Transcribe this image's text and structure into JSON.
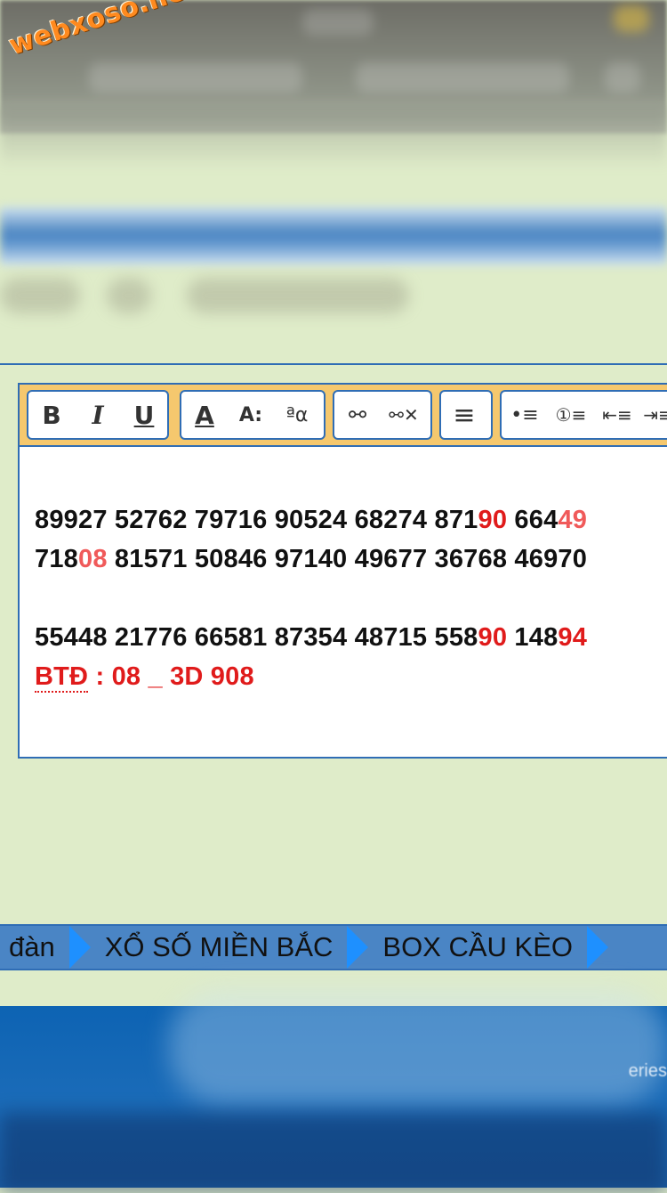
{
  "watermark": "webxoso.net",
  "toolbar": {
    "bold": "B",
    "italic": "I",
    "underline": "U",
    "font_color": "A",
    "font_size": "A:",
    "font_family": "ªα",
    "link": "⚯",
    "unlink": "⚯✕",
    "align_left": "≡",
    "bullet_list": "•≡",
    "numbered_list": "①≡",
    "outdent": "⇤≡",
    "indent": "⇥≡"
  },
  "post": {
    "line1": [
      {
        "t": "89927 52762 79716 90524 68274 871",
        "c": ""
      },
      {
        "t": "90",
        "c": "red"
      },
      {
        "t": " 664",
        "c": ""
      },
      {
        "t": "49",
        "c": "pink"
      }
    ],
    "line2": [
      {
        "t": "718",
        "c": ""
      },
      {
        "t": "08",
        "c": "pink"
      },
      {
        "t": " 81571 50846 97140 49677 36768 46970",
        "c": ""
      }
    ],
    "line3": [
      {
        "t": "55448 21776 66581 87354 48715 558",
        "c": ""
      },
      {
        "t": "90",
        "c": "red"
      },
      {
        "t": " 148",
        "c": ""
      },
      {
        "t": "94",
        "c": "red"
      }
    ],
    "btd_label": "BTĐ",
    "btd_rest": " : 08 _ 3D 908"
  },
  "nav": {
    "items": [
      "đàn",
      "XỔ SỐ MIỀN BẮC",
      "BOX CẦU KÈO"
    ]
  },
  "footer_fragment": "eries",
  "colors": {
    "accent_blue": "#2f6db5",
    "toolbar_bg": "#f5c86e",
    "highlight_red": "#e01b1b",
    "highlight_pink": "#f05a5a",
    "page_bg": "#dfecc9"
  }
}
